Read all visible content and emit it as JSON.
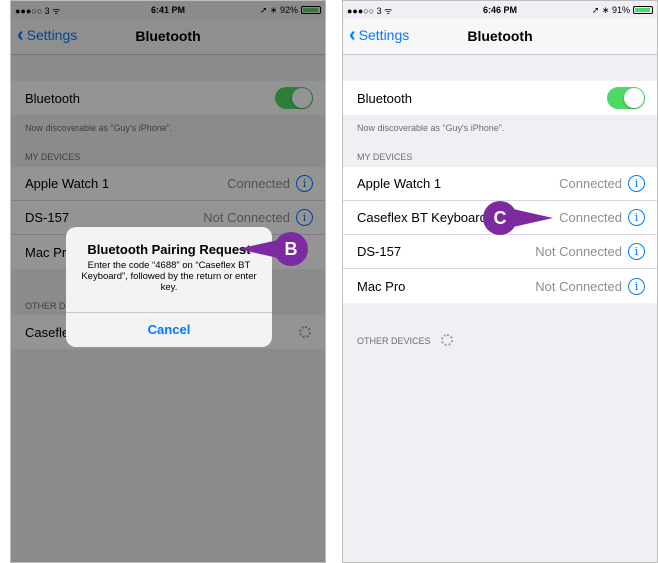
{
  "left_phone": {
    "status": {
      "carrier": "●●●○○ 3 ᯤ",
      "time": "6:41 PM",
      "battery": "➚ ∗ 92%",
      "battery_level": 0.92
    },
    "nav": {
      "back_label": "Settings",
      "title": "Bluetooth"
    },
    "bluetooth_label": "Bluetooth",
    "bluetooth_on": true,
    "discoverable": "Now discoverable as “Guy's iPhone”.",
    "my_devices_header": "MY DEVICES",
    "devices": [
      {
        "name": "Apple Watch 1",
        "status": "Connected"
      },
      {
        "name": "DS-157",
        "status": "Not Connected"
      },
      {
        "name": "Mac Pr",
        "status": ""
      }
    ],
    "other_devices_header": "OTHER D",
    "other_device": "Casefle",
    "alert": {
      "title": "Bluetooth Pairing Request",
      "message": "Enter the code “4688” on “Caseflex BT Keyboard”, followed by the return or enter key.",
      "cancel": "Cancel"
    },
    "callout": "B"
  },
  "right_phone": {
    "status": {
      "carrier": "●●●○○ 3 ᯤ",
      "time": "6:46 PM",
      "battery": "➚ ∗ 91%",
      "battery_level": 0.91
    },
    "nav": {
      "back_label": "Settings",
      "title": "Bluetooth"
    },
    "bluetooth_label": "Bluetooth",
    "bluetooth_on": true,
    "discoverable": "Now discoverable as “Guy's iPhone”.",
    "my_devices_header": "MY DEVICES",
    "devices": [
      {
        "name": "Apple Watch 1",
        "status": "Connected"
      },
      {
        "name": "Caseflex BT Keyboard",
        "status": "Connected"
      },
      {
        "name": "DS-157",
        "status": "Not Connected"
      },
      {
        "name": "Mac Pro",
        "status": "Not Connected"
      }
    ],
    "other_devices_header": "OTHER DEVICES",
    "callout": "C"
  },
  "colors": {
    "accent": "#007aff",
    "toggle_on": "#4cd964",
    "callout": "#7b2aa0"
  },
  "icons": [
    "back-chevron-icon",
    "info-icon",
    "spinner-icon",
    "battery-icon",
    "wifi-icon"
  ]
}
